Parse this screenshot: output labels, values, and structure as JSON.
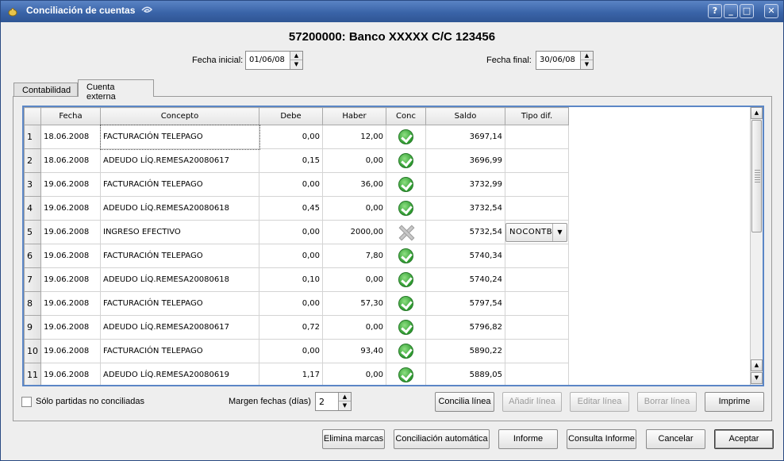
{
  "window": {
    "title": "Conciliación de cuentas",
    "controls": {
      "help": "?",
      "minimize": "_",
      "maximize": "□",
      "close": "✕"
    }
  },
  "header": {
    "account_title": "57200000: Banco XXXXX C/C 123456",
    "fecha_inicial_label": "Fecha inicial:",
    "fecha_inicial_value": "01/06/08",
    "fecha_final_label": "Fecha final:",
    "fecha_final_value": "30/06/08"
  },
  "tabs": [
    {
      "label": "Contabilidad",
      "active": false
    },
    {
      "label": "Cuenta externa",
      "active": true
    }
  ],
  "grid": {
    "columns": [
      "Fecha",
      "Concepto",
      "Debe",
      "Haber",
      "Conc",
      "Saldo",
      "Tipo dif."
    ],
    "rows": [
      {
        "n": "1",
        "fecha": "18.06.2008",
        "concepto": "FACTURACIÓN TELEPAGO",
        "debe": "0,00",
        "haber": "12,00",
        "conc": "check",
        "saldo": "3697,14",
        "tipo": ""
      },
      {
        "n": "2",
        "fecha": "18.06.2008",
        "concepto": "ADEUDO LÍQ.REMESA20080617",
        "debe": "0,15",
        "haber": "0,00",
        "conc": "check",
        "saldo": "3696,99",
        "tipo": ""
      },
      {
        "n": "3",
        "fecha": "19.06.2008",
        "concepto": "FACTURACIÓN TELEPAGO",
        "debe": "0,00",
        "haber": "36,00",
        "conc": "check",
        "saldo": "3732,99",
        "tipo": ""
      },
      {
        "n": "4",
        "fecha": "19.06.2008",
        "concepto": "ADEUDO LÍQ.REMESA20080618",
        "debe": "0,45",
        "haber": "0,00",
        "conc": "check",
        "saldo": "3732,54",
        "tipo": ""
      },
      {
        "n": "5",
        "fecha": "19.06.2008",
        "concepto": "INGRESO EFECTIVO",
        "debe": "0,00",
        "haber": "2000,00",
        "conc": "cross",
        "saldo": "5732,54",
        "tipo": "NOCONTB"
      },
      {
        "n": "6",
        "fecha": "19.06.2008",
        "concepto": "FACTURACIÓN TELEPAGO",
        "debe": "0,00",
        "haber": "7,80",
        "conc": "check",
        "saldo": "5740,34",
        "tipo": ""
      },
      {
        "n": "7",
        "fecha": "19.06.2008",
        "concepto": "ADEUDO LÍQ.REMESA20080618",
        "debe": "0,10",
        "haber": "0,00",
        "conc": "check",
        "saldo": "5740,24",
        "tipo": ""
      },
      {
        "n": "8",
        "fecha": "19.06.2008",
        "concepto": "FACTURACIÓN TELEPAGO",
        "debe": "0,00",
        "haber": "57,30",
        "conc": "check",
        "saldo": "5797,54",
        "tipo": ""
      },
      {
        "n": "9",
        "fecha": "19.06.2008",
        "concepto": "ADEUDO LÍQ.REMESA20080617",
        "debe": "0,72",
        "haber": "0,00",
        "conc": "check",
        "saldo": "5796,82",
        "tipo": ""
      },
      {
        "n": "10",
        "fecha": "19.06.2008",
        "concepto": "FACTURACIÓN TELEPAGO",
        "debe": "0,00",
        "haber": "93,40",
        "conc": "check",
        "saldo": "5890,22",
        "tipo": ""
      },
      {
        "n": "11",
        "fecha": "19.06.2008",
        "concepto": "ADEUDO LÍQ.REMESA20080619",
        "debe": "1,17",
        "haber": "0,00",
        "conc": "check",
        "saldo": "5889,05",
        "tipo": ""
      }
    ]
  },
  "filters": {
    "solo_no_conciliadas_label": "Sólo partidas no conciliadas",
    "solo_no_conciliadas_checked": false,
    "margen_label": "Margen fechas (días)",
    "margen_value": "2"
  },
  "panel_buttons": {
    "concilia": "Concilia línea",
    "anadir": "Añadir línea",
    "editar": "Editar línea",
    "borrar": "Borrar línea",
    "imprime": "Imprime"
  },
  "bottom_buttons": {
    "elimina": "Elimina marcas",
    "automatica": "Conciliación automática",
    "informe": "Informe",
    "consulta": "Consulta Informe",
    "cancelar": "Cancelar",
    "aceptar": "Aceptar"
  },
  "colors": {
    "titlebar": "#3a64a8",
    "grid_focus_border": "#5b86c6",
    "check_green": "#2d9a2f"
  }
}
